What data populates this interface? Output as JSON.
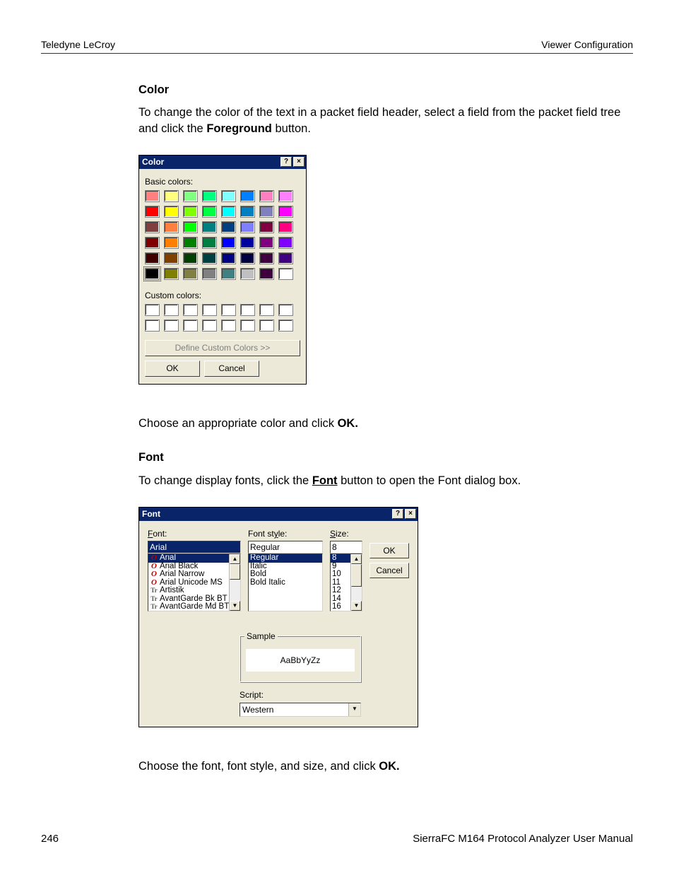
{
  "header": {
    "left": "Teledyne LeCroy",
    "right": "Viewer Configuration"
  },
  "footer": {
    "page": "246",
    "manual": "SierraFC M164 Protocol Analyzer User Manual"
  },
  "sections": {
    "color_heading": "Color",
    "color_para_a": "To change the color of the text in a packet field header, select a field from the packet field tree and click the ",
    "color_para_b": "Foreground",
    "color_para_c": " button.",
    "choose_color_a": "Choose an appropriate color and click ",
    "choose_color_b": "OK.",
    "font_heading": "Font",
    "font_para_a": "To change display fonts, click the ",
    "font_para_b": "Font",
    "font_para_c": " button to open the Font dialog box.",
    "choose_font_a": "Choose the font, font style, and size, and click ",
    "choose_font_b": "OK."
  },
  "color_dialog": {
    "title": "Color",
    "help_btn": "?",
    "close_btn": "×",
    "basic_label": "Basic colors:",
    "custom_label": "Custom colors:",
    "define_btn": "Define Custom Colors >>",
    "ok_btn": "OK",
    "cancel_btn": "Cancel",
    "basic_colors": [
      [
        "#ff8080",
        "#ffff80",
        "#80ff80",
        "#00ff80",
        "#80ffff",
        "#0080ff",
        "#ff80c0",
        "#ff80ff"
      ],
      [
        "#ff0000",
        "#ffff00",
        "#80ff00",
        "#00ff40",
        "#00ffff",
        "#0080c0",
        "#8080c0",
        "#ff00ff"
      ],
      [
        "#804040",
        "#ff8040",
        "#00ff00",
        "#008080",
        "#004080",
        "#8080ff",
        "#800040",
        "#ff0080"
      ],
      [
        "#800000",
        "#ff8000",
        "#008000",
        "#008040",
        "#0000ff",
        "#0000a0",
        "#800080",
        "#8000ff"
      ],
      [
        "#400000",
        "#804000",
        "#004000",
        "#004040",
        "#000080",
        "#000040",
        "#400040",
        "#400080"
      ],
      [
        "#000000",
        "#808000",
        "#808040",
        "#808080",
        "#408080",
        "#c0c0c0",
        "#400040",
        "#ffffff"
      ]
    ],
    "selected_row": 5,
    "selected_col": 0,
    "custom_rows": 2,
    "custom_cols": 8
  },
  "font_dialog": {
    "title": "Font",
    "help_btn": "?",
    "close_btn": "×",
    "labels": {
      "font": "Font:",
      "style": "Font style:",
      "size": "Size:",
      "sample": "Sample",
      "script": "Script:",
      "script_underline_char": "r"
    },
    "font_value": "Arial",
    "style_value": "Regular",
    "size_value": "8",
    "ok_btn": "OK",
    "cancel_btn": "Cancel",
    "fonts": [
      {
        "icon": "o",
        "name": "Arial",
        "sel": true
      },
      {
        "icon": "o",
        "name": "Arial Black"
      },
      {
        "icon": "o",
        "name": "Arial Narrow"
      },
      {
        "icon": "o",
        "name": "Arial Unicode MS"
      },
      {
        "icon": "tt",
        "name": "Artistik"
      },
      {
        "icon": "tt",
        "name": "AvantGarde Bk BT"
      },
      {
        "icon": "tt",
        "name": "AvantGarde Md BT"
      }
    ],
    "styles": [
      "Regular",
      "Italic",
      "Bold",
      "Bold Italic"
    ],
    "sizes": [
      "8",
      "9",
      "10",
      "11",
      "12",
      "14",
      "16"
    ],
    "sample_text": "AaBbYyZz",
    "script_value": "Western"
  }
}
